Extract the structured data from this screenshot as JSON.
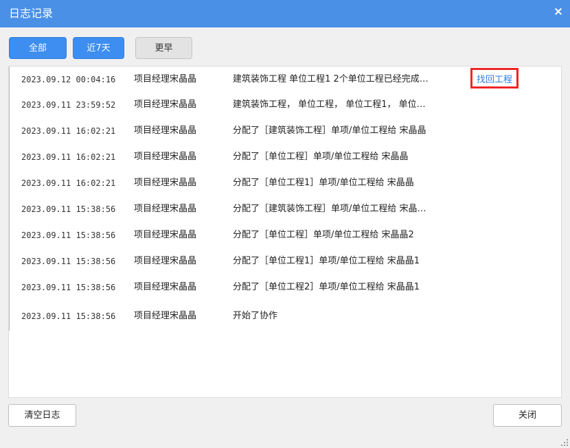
{
  "window": {
    "title": "日志记录",
    "close_symbol": "×"
  },
  "filters": [
    {
      "label": "全部",
      "state": "active"
    },
    {
      "label": "近7天",
      "state": "active"
    },
    {
      "label": "更早",
      "state": "inactive"
    }
  ],
  "logs": [
    {
      "time": "2023.09.12 00:04:16",
      "user": "项目经理宋晶晶",
      "message": "建筑装饰工程 单位工程1 2个单位工程已经完成…",
      "action": "找回工程"
    },
    {
      "time": "2023.09.11 23:59:52",
      "user": "项目经理宋晶晶",
      "message": "建筑装饰工程， 单位工程， 单位工程1， 单位…"
    },
    {
      "time": "2023.09.11 16:02:21",
      "user": "项目经理宋晶晶",
      "message": "分配了［建筑装饰工程］单项/单位工程给 宋晶晶"
    },
    {
      "time": "2023.09.11 16:02:21",
      "user": "项目经理宋晶晶",
      "message": "分配了［单位工程］单项/单位工程给 宋晶晶"
    },
    {
      "time": "2023.09.11 16:02:21",
      "user": "项目经理宋晶晶",
      "message": "分配了［单位工程1］单项/单位工程给 宋晶晶"
    },
    {
      "time": "2023.09.11 15:38:56",
      "user": "项目经理宋晶晶",
      "message": "分配了［建筑装饰工程］单项/单位工程给 宋晶…"
    },
    {
      "time": "2023.09.11 15:38:56",
      "user": "项目经理宋晶晶",
      "message": "分配了［单位工程］单项/单位工程给 宋晶晶2"
    },
    {
      "time": "2023.09.11 15:38:56",
      "user": "项目经理宋晶晶",
      "message": "分配了［单位工程1］单项/单位工程给 宋晶晶1"
    },
    {
      "time": "2023.09.11 15:38:56",
      "user": "项目经理宋晶晶",
      "message": "分配了［单位工程2］单项/单位工程给 宋晶晶1"
    },
    {
      "time": "2023.09.11 15:38:56",
      "user": "项目经理宋晶晶",
      "message": "开始了协作"
    }
  ],
  "footer": {
    "clear_label": "清空日志",
    "close_label": "关闭"
  },
  "colors": {
    "title_bar": "#4a90e6",
    "active_button": "#3d8ef0",
    "link": "#2d7de0",
    "highlight_border": "#ee2525"
  },
  "icons": {
    "close": "close-icon",
    "resize": "resize-grip-icon"
  }
}
